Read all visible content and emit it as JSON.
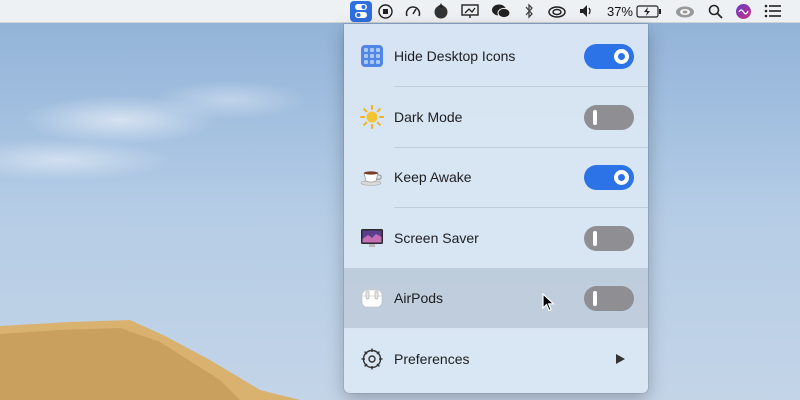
{
  "menubar": {
    "battery_percent": "37%",
    "icons": [
      "one-switch-icon",
      "record-icon",
      "speedometer-icon",
      "tomato-icon",
      "presentation-icon",
      "wechat-icon",
      "bluetooth-icon",
      "creative-cloud-icon",
      "volume-icon",
      "battery-icon",
      "cc-icon",
      "search-icon",
      "siri-icon",
      "control-list-icon"
    ]
  },
  "panel": {
    "items": [
      {
        "label": "Hide Desktop Icons",
        "icon": "grid-icon",
        "toggle": "on"
      },
      {
        "label": "Dark Mode",
        "icon": "sun-icon",
        "toggle": "off"
      },
      {
        "label": "Keep Awake",
        "icon": "coffee-cup-icon",
        "toggle": "on"
      },
      {
        "label": "Screen Saver",
        "icon": "screen-saver-icon",
        "toggle": "off"
      },
      {
        "label": "AirPods",
        "icon": "airpods-icon",
        "toggle": "off"
      }
    ],
    "preferences_label": "Preferences"
  },
  "colors": {
    "accent": "#2b73e6",
    "toggle_off": "#8e8e93",
    "menubar_active": "#2f6fde"
  }
}
